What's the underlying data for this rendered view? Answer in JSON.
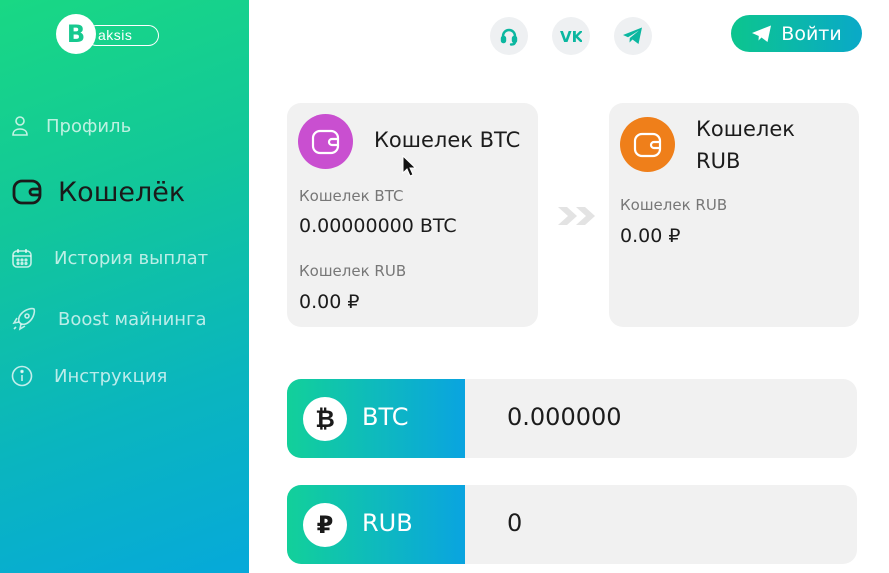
{
  "brand": {
    "logo_letter": "B",
    "name": "aksis"
  },
  "sidebar": {
    "items": [
      {
        "label": "Профиль",
        "icon": "user-icon",
        "active": false
      },
      {
        "label": "Кошелёк",
        "icon": "wallet-icon",
        "active": true
      },
      {
        "label": "История выплат",
        "icon": "calendar-icon",
        "active": false
      },
      {
        "label": "Boost майнинга",
        "icon": "rocket-icon",
        "active": false
      },
      {
        "label": "Инструкция",
        "icon": "info-icon",
        "active": false
      }
    ]
  },
  "header": {
    "icons": [
      "headset-icon",
      "vk-icon",
      "telegram-icon"
    ],
    "login_label": "Войти"
  },
  "wallets": {
    "btc": {
      "title": "Кошелек BTC",
      "rows": [
        {
          "label": "Кошелек BTC",
          "value": "0.00000000 BTC"
        },
        {
          "label": "Кошелек RUB",
          "value": "0.00 ₽"
        }
      ],
      "icon_color": "#c94fd0"
    },
    "rub": {
      "title_line1": "Кошелек",
      "title_line2": "RUB",
      "rows": [
        {
          "label": "Кошелек RUB",
          "value": "0.00 ₽"
        }
      ],
      "icon_color": "#ef7f1a"
    }
  },
  "balances": [
    {
      "currency": "BTC",
      "symbol": "₿",
      "value": "0.000000"
    },
    {
      "currency": "RUB",
      "symbol": "₽",
      "value": "0"
    }
  ],
  "colors": {
    "accent_green": "#19d884",
    "accent_blue": "#06a9da",
    "card_bg": "#f1f1f1"
  }
}
